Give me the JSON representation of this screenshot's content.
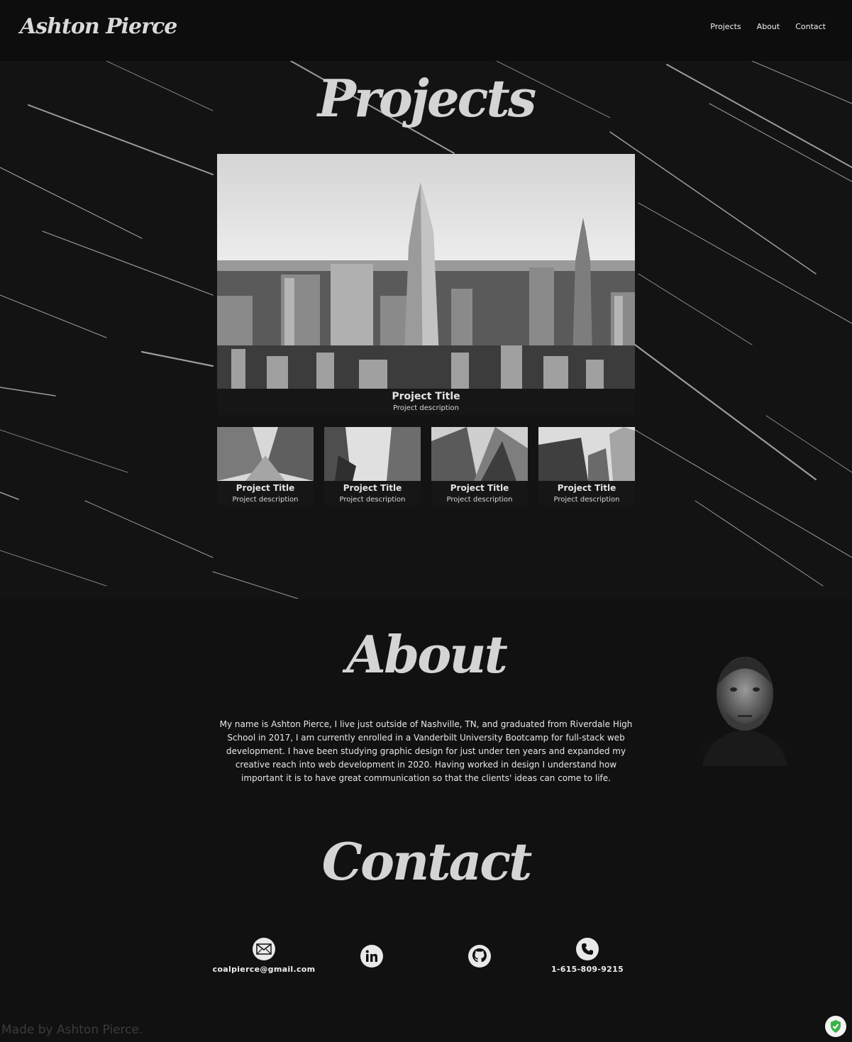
{
  "header": {
    "logo": "Ashton Pierce",
    "nav": [
      "Projects",
      "About",
      "Contact"
    ]
  },
  "projects": {
    "title": "Projects",
    "featured": {
      "title": "Project Title",
      "description": "Project description"
    },
    "items": [
      {
        "title": "Project Title",
        "description": "Project description"
      },
      {
        "title": "Project Title",
        "description": "Project description"
      },
      {
        "title": "Project Title",
        "description": "Project description"
      },
      {
        "title": "Project Title",
        "description": "Project description"
      }
    ]
  },
  "about": {
    "title": "About",
    "text": "My name is Ashton Pierce, I live just outside of Nashville, TN, and graduated from Riverdale High School in 2017, I am currently enrolled in a Vanderbilt University Bootcamp for full-stack web development. I have been studying graphic design for just under ten years and expanded my creative reach into web development in 2020. Having worked in design I understand how important it is to have great communication so that the clients' ideas can come to life."
  },
  "contact": {
    "title": "Contact",
    "items": [
      {
        "icon": "envelope-icon",
        "label": "coalpierce@gmail.com"
      },
      {
        "icon": "linkedin-icon",
        "label": ""
      },
      {
        "icon": "github-icon",
        "label": ""
      },
      {
        "icon": "phone-icon",
        "label": "1-615-809-9215"
      }
    ]
  },
  "footer": {
    "text": "Made by Ashton Pierce."
  },
  "colors": {
    "background": "#111112",
    "header": "#0d0d0e",
    "text": "#e6e6e6",
    "badge_check": "#3bb34a"
  }
}
